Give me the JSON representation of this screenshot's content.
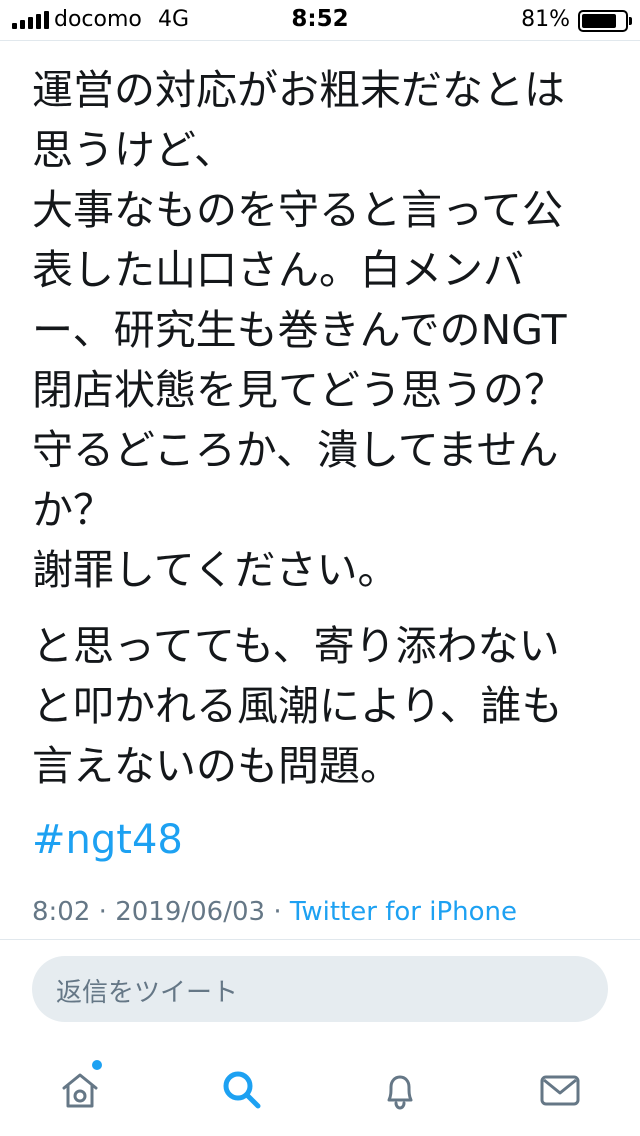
{
  "status_bar": {
    "carrier": "docomo",
    "network": "4G",
    "time": "8:52",
    "battery_percent": "81%",
    "battery_level": 0.81
  },
  "tweet": {
    "paragraph1": [
      "運営の対応がお粗末だなとは",
      "思うけど、",
      "大事なものを守ると言って公",
      "表した山口さん。白メンバ",
      "ー、研究生も巻きんでのNGT",
      "閉店状態を見てどう思うの？",
      "守るどころか、潰してません",
      "か？",
      "謝罪してください。"
    ],
    "paragraph2": [
      "と思ってても、寄り添わない",
      "と叩かれる風潮により、誰も",
      "言えないのも問題。"
    ],
    "hashtag": "#ngt48"
  },
  "meta": {
    "time": "8:02",
    "separator": "·",
    "date": "2019/06/03",
    "source": "Twitter for iPhone"
  },
  "reply": {
    "placeholder": "返信をツイート"
  },
  "tab_bar": {
    "tabs": [
      "home-icon",
      "search-icon",
      "bell-icon",
      "mail-icon"
    ],
    "active_tab": "search-icon",
    "accent_color": "#1da1f2",
    "icon_color": "#657786"
  },
  "colors": {
    "text": "#14171a",
    "secondary": "#657786",
    "accent": "#1da1f2",
    "reply_bg": "#e6ecf0"
  }
}
